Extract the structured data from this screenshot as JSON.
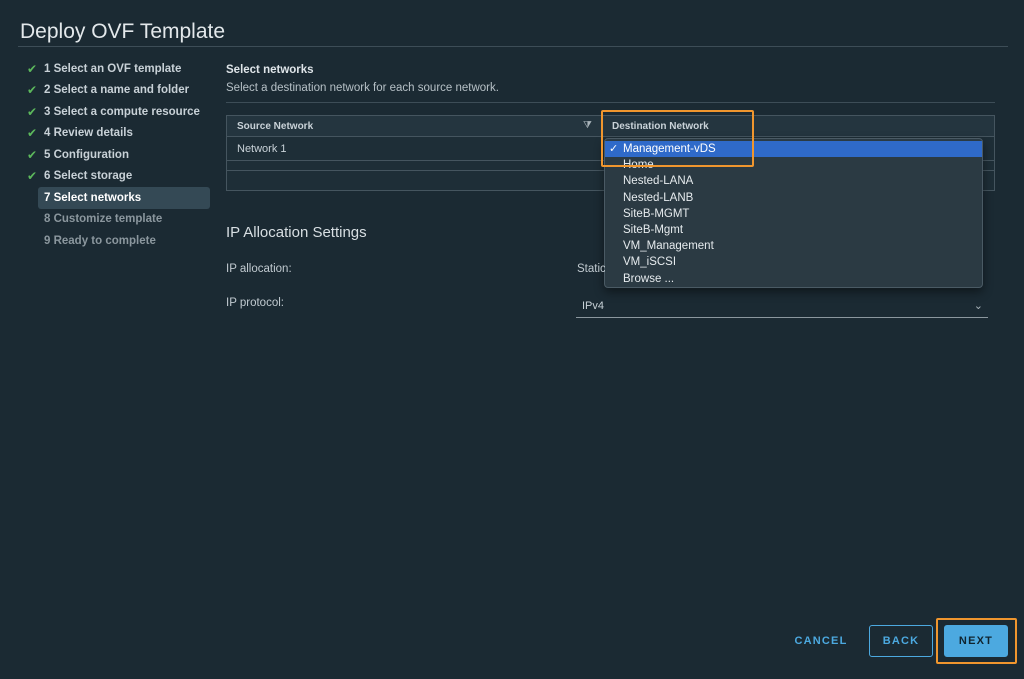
{
  "window": {
    "title": "Deploy OVF Template"
  },
  "steps": [
    {
      "label": "1 Select an OVF template",
      "state": "done"
    },
    {
      "label": "2 Select a name and folder",
      "state": "done"
    },
    {
      "label": "3 Select a compute resource",
      "state": "done"
    },
    {
      "label": "4 Review details",
      "state": "done"
    },
    {
      "label": "5 Configuration",
      "state": "done"
    },
    {
      "label": "6 Select storage",
      "state": "done"
    },
    {
      "label": "7 Select networks",
      "state": "active"
    },
    {
      "label": "8 Customize template",
      "state": "pending"
    },
    {
      "label": "9 Ready to complete",
      "state": "pending"
    }
  ],
  "section": {
    "title": "Select networks",
    "subtitle": "Select a destination network for each source network."
  },
  "grid": {
    "columns": [
      "Source Network",
      "Destination Network"
    ],
    "rows": [
      {
        "source": "Network 1",
        "destination": "Management-vDS"
      }
    ]
  },
  "dropdown": {
    "selected": "Management-vDS",
    "options": [
      "Management-vDS",
      "Home",
      "Nested-LANA",
      "Nested-LANB",
      "SiteB-MGMT",
      "SiteB-Mgmt",
      "VM_Management",
      "VM_iSCSI",
      "Browse ..."
    ]
  },
  "ip_settings": {
    "title": "IP Allocation Settings",
    "allocation_label": "IP allocation:",
    "allocation_value": "Static",
    "protocol_label": "IP protocol:",
    "protocol_value": "IPv4"
  },
  "buttons": {
    "cancel": "CANCEL",
    "back": "BACK",
    "next": "NEXT"
  },
  "icons": {
    "check": "✔",
    "filter": "⧩",
    "tick": "✓",
    "chevron": "⌄"
  },
  "colors": {
    "background": "#1b2a33",
    "accent": "#4ca9e0",
    "highlight": "#f0962e",
    "selected_option": "#2f6ac9",
    "done_check": "#5cb85c"
  }
}
